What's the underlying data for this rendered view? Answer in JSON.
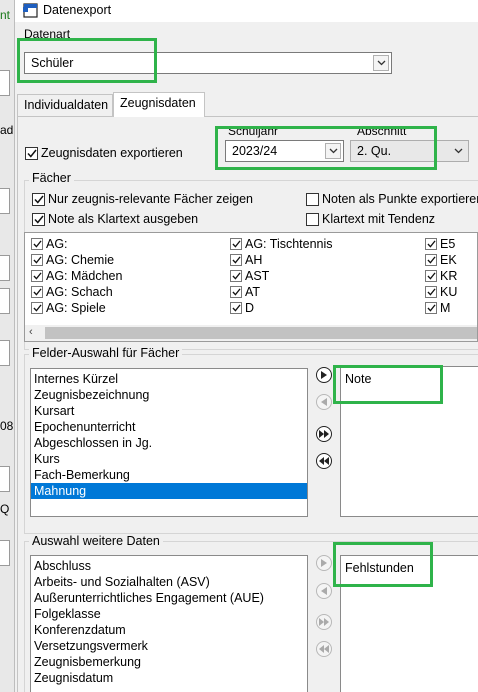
{
  "background_window": {
    "fragments": [
      "nt",
      "ad",
      "08",
      "Q"
    ]
  },
  "window": {
    "title": "Datenexport"
  },
  "datenart": {
    "label": "Datenart",
    "value": "Schüler"
  },
  "tabs": [
    {
      "label": "Individualdaten"
    },
    {
      "label": "Zeugnisdaten"
    }
  ],
  "zeugnis": {
    "export_label": "Zeugnisdaten exportieren",
    "export_checked": true
  },
  "schuljahr": {
    "label": "Schuljahr",
    "value": "2023/24"
  },
  "abschnitt": {
    "label": "Abschnitt",
    "value": "2. Qu."
  },
  "faecher": {
    "legend": "Fächer",
    "options": [
      {
        "label": "Nur zeugnis-relevante Fächer zeigen",
        "checked": true
      },
      {
        "label": "Noten als Punkte exportieren",
        "checked": false
      },
      {
        "label": "Note als Klartext ausgeben",
        "checked": true
      },
      {
        "label": "Klartext mit Tendenz",
        "checked": false
      }
    ],
    "grid_col1": [
      "AG:",
      "AG: Chemie",
      "AG: Mädchen",
      "AG: Schach",
      "AG: Spiele"
    ],
    "grid_col2": [
      "AG: Tischtennis",
      "AH",
      "AST",
      "AT",
      "D"
    ],
    "grid_col3": [
      "E5",
      "EK",
      "KR",
      "KU",
      "M"
    ]
  },
  "felder": {
    "legend": "Felder-Auswahl für Fächer",
    "available": [
      "Internes Kürzel",
      "Zeugnisbezeichnung",
      "Kursart",
      "Epochenunterricht",
      "Abgeschlossen in Jg.",
      "Kurs",
      "Fach-Bemerkung",
      "Mahnung"
    ],
    "selected_index": 7,
    "chosen": [
      "Note"
    ]
  },
  "weitere": {
    "legend": "Auswahl weitere Daten",
    "available": [
      "Abschluss",
      "Arbeits- und Sozialhalten (ASV)",
      "Außerunterrichtliches Engagement (AUE)",
      "Folgeklasse",
      "Konferenzdatum",
      "Versetzungsvermerk",
      "Zeugnisbemerkung",
      "Zeugnisdatum"
    ],
    "chosen": [
      "Fehlstunden"
    ]
  },
  "colors": {
    "highlight": "#2fb34a",
    "selection": "#0078d7"
  }
}
